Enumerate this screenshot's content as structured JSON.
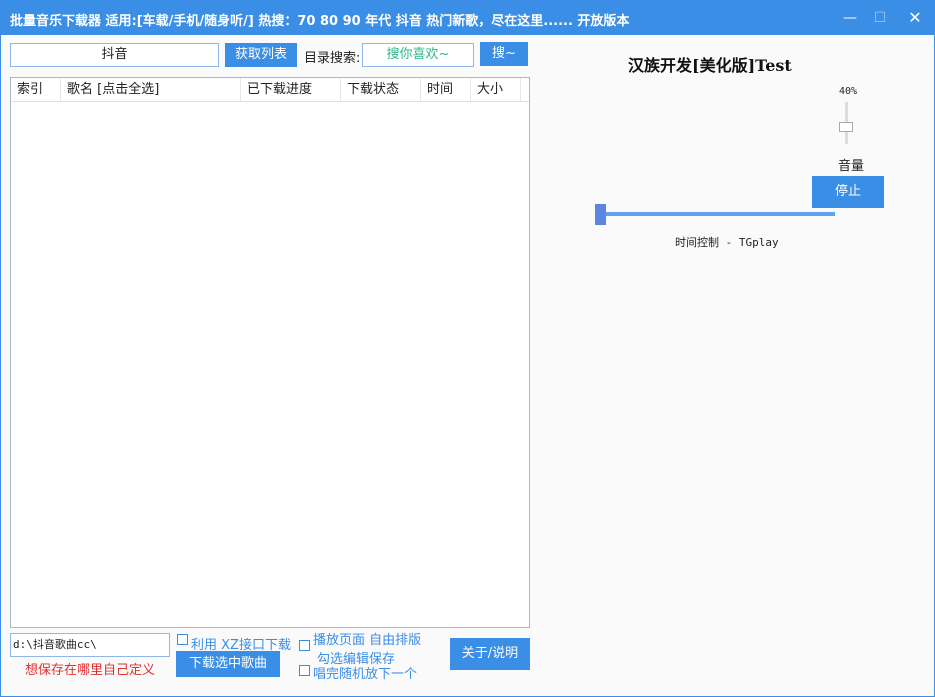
{
  "window": {
    "title": "批量音乐下载器  适用:[车载/手机/随身听/] 热搜：70 80 90 年代 抖音 热门新歌，尽在这里...... 开放版本",
    "minimize_glyph": "—",
    "maximize_glyph": "☐",
    "close_glyph": "✕"
  },
  "toolbar": {
    "search_value": "抖音",
    "fetch_label": "获取列表",
    "dir_label": "目录搜索:",
    "dir_value": "搜你喜欢~",
    "search_btn_label": "搜~"
  },
  "table": {
    "columns": [
      "索引",
      "歌名 [点击全选]",
      "已下载进度",
      "下载状态",
      "时间",
      "大小"
    ],
    "rows": []
  },
  "bottom": {
    "save_path": "d:\\抖音歌曲cc\\",
    "save_hint": "想保存在哪里自己定义",
    "xz_label": "利用 XZ接口下载",
    "download_label": "下载选中歌曲",
    "layout_label_line1": "播放页面 自由排版",
    "layout_label_line2": "勾选编辑保存",
    "random_label": "唱完随机放下一个",
    "about_label": "关于/说明"
  },
  "player": {
    "title": "汉族开发[美化版]Test",
    "volume_text": "40%",
    "volume_level": 0.4,
    "volume_label": "音量",
    "stop_label": "停止",
    "time_label": "时间控制 - TGplay",
    "progress": 0
  },
  "colors": {
    "accent": "#3a8ee6",
    "hint_red": "#e03030",
    "dir_green": "#2fb88a"
  }
}
